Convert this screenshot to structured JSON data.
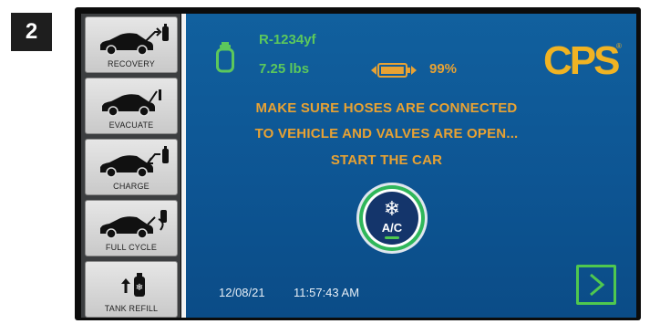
{
  "step_number": "2",
  "sidebar": {
    "items": [
      {
        "label": "RECOVERY",
        "icon": "car-recovery-icon"
      },
      {
        "label": "EVACUATE",
        "icon": "car-evacuate-icon"
      },
      {
        "label": "CHARGE",
        "icon": "car-charge-icon"
      },
      {
        "label": "FULL CYCLE",
        "icon": "car-full-cycle-icon"
      },
      {
        "label": "TANK REFILL",
        "icon": "tank-refill-icon"
      }
    ]
  },
  "status": {
    "refrigerant": "R-1234yf",
    "weight": "7.25 lbs",
    "battery_percent": "99%",
    "battery_level": 0.99
  },
  "brand": {
    "name": "CPS",
    "mark": "®",
    "color": "#f0b323"
  },
  "message": {
    "line1": "MAKE SURE HOSES ARE CONNECTED",
    "line2": "TO VEHICLE AND VALVES ARE OPEN...",
    "line3": "START THE CAR"
  },
  "ac_button": {
    "label": "A/C",
    "icon": "snowflake-icon"
  },
  "footer": {
    "date": "12/08/21",
    "time": "11:57:43 AM"
  },
  "next_button": {
    "icon": "chevron-right-icon"
  },
  "colors": {
    "screen_blue": "#0d5593",
    "label_green": "#5cc85c",
    "message_orange": "#e8a233",
    "accent_green": "#4fc84f"
  }
}
